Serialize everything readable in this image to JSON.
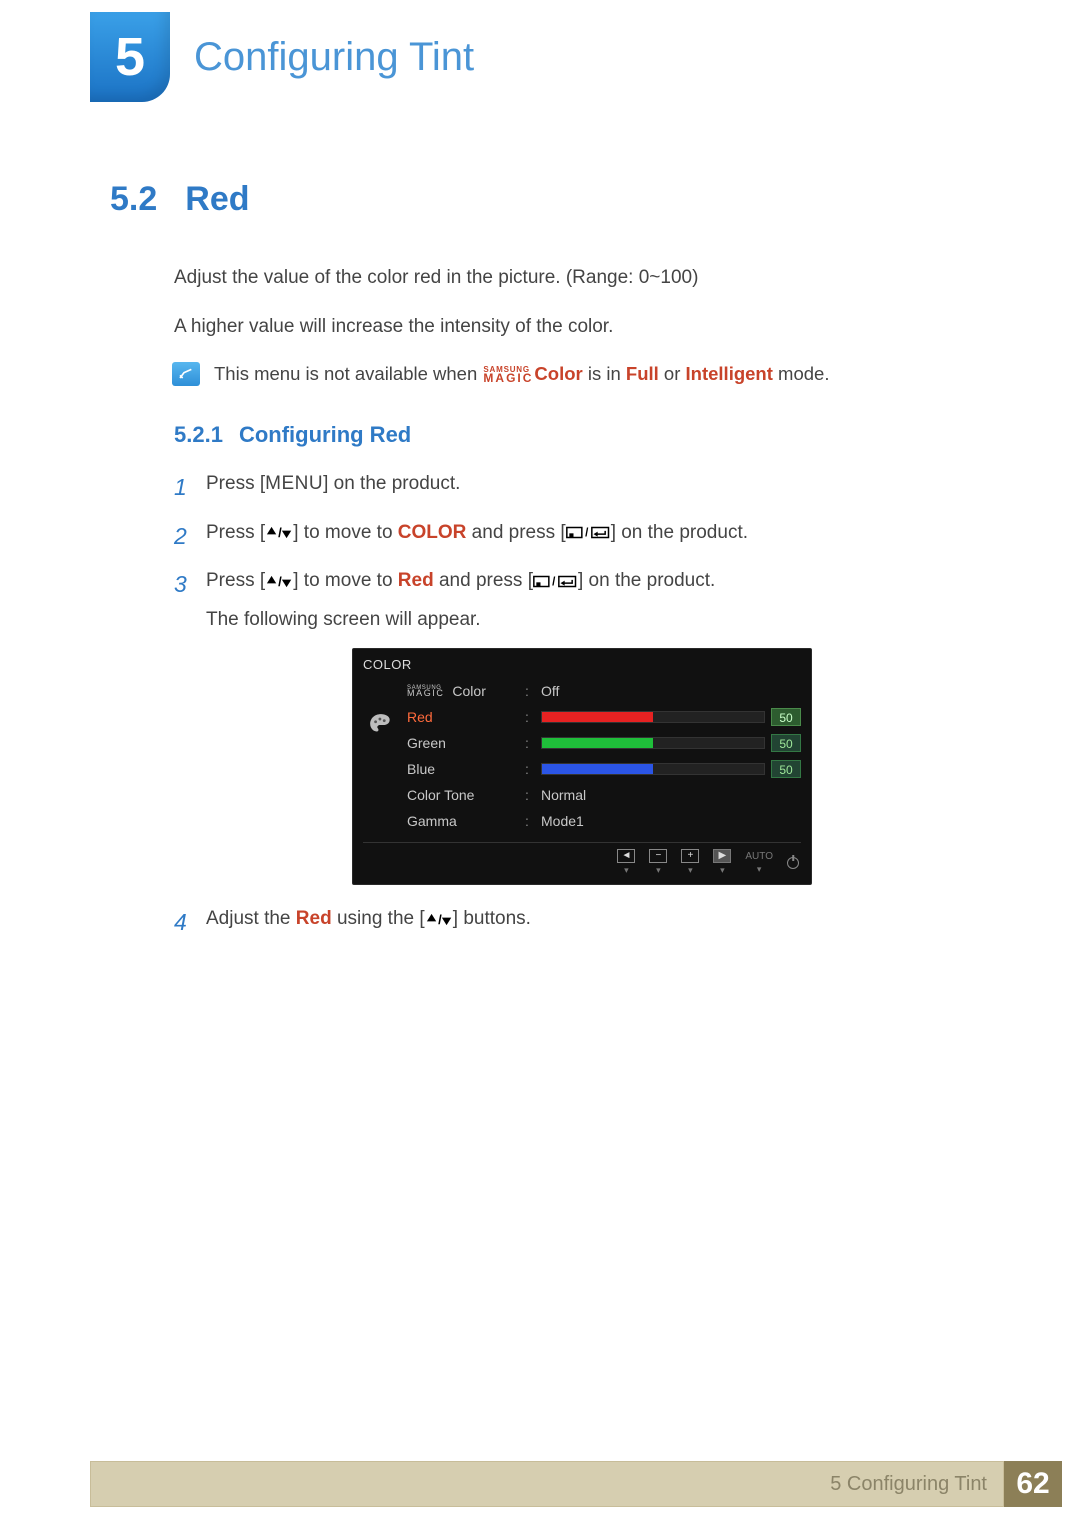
{
  "chapter": {
    "number": "5",
    "title": "Configuring Tint"
  },
  "section": {
    "number": "5.2",
    "title": "Red",
    "intro1": "Adjust the value of the color red in the picture. (Range: 0~100)",
    "intro2": "A higher value will increase the intensity of the color.",
    "note_prefix": "This menu is not available when ",
    "note_color": "Color",
    "note_mid": " is in ",
    "note_full": "Full",
    "note_or": " or ",
    "note_intelligent": "Intelligent",
    "note_suffix": " mode."
  },
  "subsection": {
    "number": "5.2.1",
    "title": "Configuring Red"
  },
  "steps": {
    "s1_a": "Press [",
    "s1_menu": "MENU",
    "s1_b": "] on the product.",
    "s2_a": "Press [",
    "s2_b": "] to move to ",
    "s2_color": "COLOR",
    "s2_c": " and press [",
    "s2_d": "] on the product.",
    "s3_a": "Press [",
    "s3_b": "] to move to ",
    "s3_red": "Red",
    "s3_c": " and press [",
    "s3_d": "] on the product.",
    "s3_follow": "The following screen will appear.",
    "s4_a": "Adjust the ",
    "s4_red": "Red",
    "s4_b": " using the [",
    "s4_c": "] buttons."
  },
  "osd": {
    "title": "COLOR",
    "samsung_top": "SAMSUNG",
    "samsung_bot": "MAGIC",
    "rows": {
      "magic_color": {
        "label_suffix": "Color",
        "value": "Off"
      },
      "red": {
        "label": "Red",
        "value": "50",
        "fill": "50%",
        "color": "#e62222",
        "active": true
      },
      "green": {
        "label": "Green",
        "value": "50",
        "fill": "50%",
        "color": "#1fbf3a"
      },
      "blue": {
        "label": "Blue",
        "value": "50",
        "fill": "50%",
        "color": "#2b55e6"
      },
      "color_tone": {
        "label": "Color Tone",
        "value": "Normal"
      },
      "gamma": {
        "label": "Gamma",
        "value": "Mode1"
      }
    },
    "buttons": {
      "auto": "AUTO"
    }
  },
  "footer": {
    "chapter_ref": "5 Configuring Tint",
    "page": "62"
  }
}
